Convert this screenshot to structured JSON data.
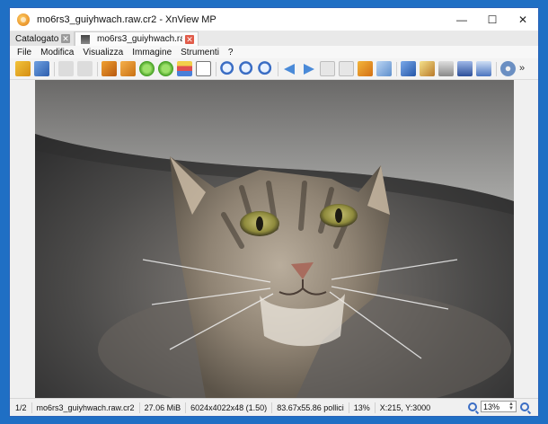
{
  "window": {
    "title": "mo6rs3_guiyhwach.raw.cr2 - XnView MP",
    "controls": {
      "minimize": "—",
      "maximize": "☐",
      "close": "✕"
    }
  },
  "tabs": [
    {
      "label": "Catalogatore",
      "active": false
    },
    {
      "label": "mo6rs3_guiyhwach.raw....",
      "active": true
    }
  ],
  "menu": [
    "File",
    "Modifica",
    "Visualizza",
    "Immagine",
    "Strumenti",
    "?"
  ],
  "toolbar_icons": [
    "open-browser-icon",
    "save-icon",
    "undo-icon",
    "redo-icon",
    "crop-icon",
    "resize-icon",
    "rotate-left-icon",
    "rotate-right-icon",
    "adjust-colors-icon",
    "levels-icon",
    "zoom-in-icon",
    "zoom-fit-icon",
    "zoom-out-icon",
    "previous-icon",
    "next-icon",
    "first-icon",
    "last-icon",
    "slideshow-icon",
    "open-folder-icon",
    "fullscreen-icon",
    "edit-icon",
    "print-icon",
    "scan-icon",
    "window-icon",
    "settings-gear-icon"
  ],
  "status": {
    "index": "1/2",
    "filename": "mo6rs3_guiyhwach.raw.cr2",
    "filesize": "27.06 MiB",
    "dimensions": "6024x4022x48 (1.50)",
    "print_size": "83.67x55.86 pollici",
    "zoom": "13%",
    "cursor": "X:215, Y:3000",
    "zoom_field": "13%"
  },
  "image": {
    "subject": "tabby cat under car",
    "description_colors": [
      "#6f6e6c",
      "#a39684",
      "#2f3133"
    ]
  }
}
